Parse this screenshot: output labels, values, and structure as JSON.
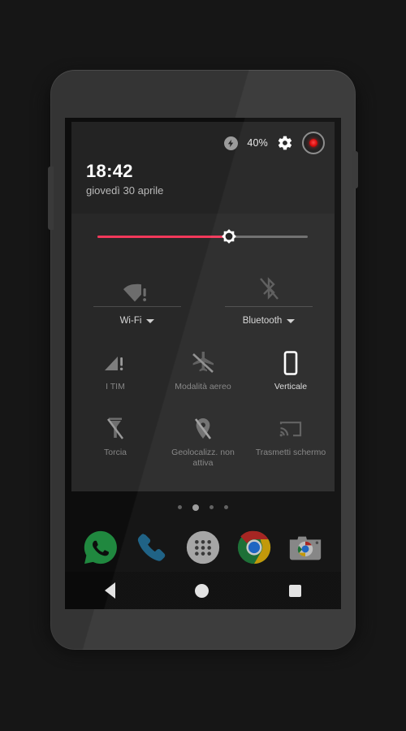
{
  "device": {
    "frame_color": "#343434",
    "screen_bg": "#0d0d0d"
  },
  "status_bar": {
    "battery_icon": "battery-charging-icon",
    "battery_percent": "40%",
    "settings_icon": "gear-icon",
    "record_icon": "screen-record-icon",
    "record_color": "#d40000"
  },
  "header": {
    "time": "18:42",
    "date": "giovedì 30 aprile"
  },
  "brightness": {
    "name": "brightness-slider",
    "value": 62,
    "fill_color": "#f2385a",
    "track_color": "#6d6d6d",
    "thumb_icon": "brightness-sun-icon"
  },
  "connectivity": [
    {
      "name": "wifi",
      "icon": "wifi-alert-icon",
      "label": "Wi-Fi",
      "enabled": false
    },
    {
      "name": "bluetooth",
      "icon": "bluetooth-off-icon",
      "label": "Bluetooth",
      "enabled": false
    }
  ],
  "tiles": [
    {
      "name": "cellular",
      "icon": "signal-alert-icon",
      "label": "I TIM",
      "enabled": false
    },
    {
      "name": "airplane-mode",
      "icon": "airplane-off-icon",
      "label": "Modalità aereo",
      "enabled": false
    },
    {
      "name": "rotation",
      "icon": "portrait-lock-icon",
      "label": "Verticale",
      "enabled": true
    },
    {
      "name": "flashlight",
      "icon": "flashlight-off-icon",
      "label": "Torcia",
      "enabled": false
    },
    {
      "name": "location",
      "icon": "location-off-icon",
      "label": "Geolocalizz. non attiva",
      "enabled": false
    },
    {
      "name": "cast",
      "icon": "cast-screen-icon",
      "label": "Trasmetti schermo",
      "enabled": false
    }
  ],
  "home": {
    "page_dots": {
      "count": 4,
      "active_index": 1
    },
    "dock": [
      {
        "name": "whatsapp",
        "icon": "whatsapp-icon",
        "label": "WhatsApp"
      },
      {
        "name": "phone",
        "icon": "phone-icon",
        "label": "Telefono"
      },
      {
        "name": "app-drawer",
        "icon": "app-drawer-icon",
        "label": "Tutte le app"
      },
      {
        "name": "chrome",
        "icon": "chrome-icon",
        "label": "Chrome"
      },
      {
        "name": "camera",
        "icon": "camera-icon",
        "label": "Fotocamera"
      }
    ]
  },
  "navigation": [
    {
      "name": "back",
      "icon": "back-triangle-icon",
      "label": "Indietro"
    },
    {
      "name": "home",
      "icon": "home-circle-icon",
      "label": "Home"
    },
    {
      "name": "recents",
      "icon": "recents-square-icon",
      "label": "Recenti"
    }
  ]
}
